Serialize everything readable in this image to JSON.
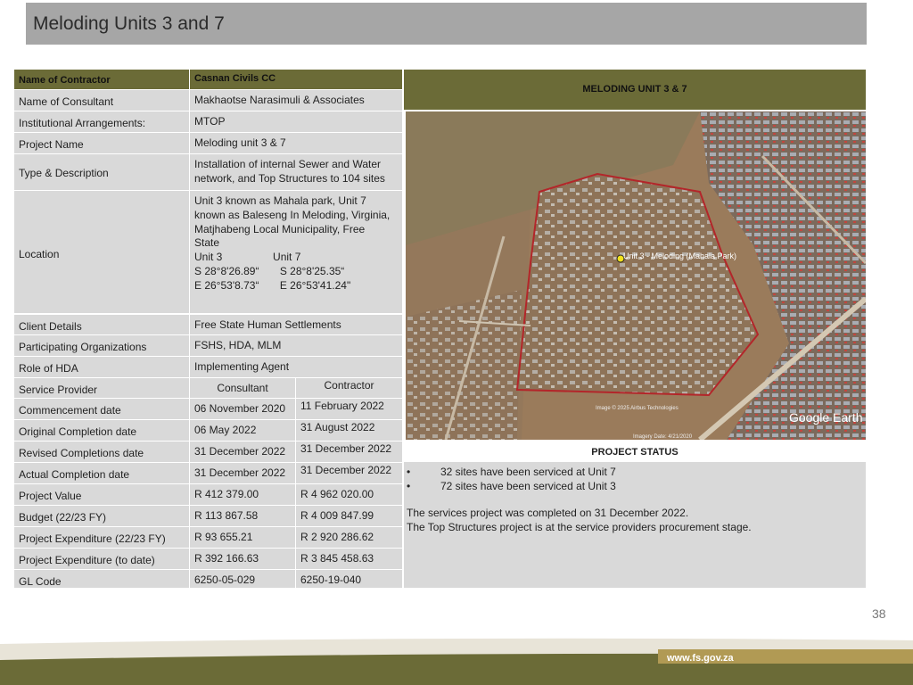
{
  "title": "Meloding Units 3 and 7",
  "header_label": "Name of Contractor",
  "header_value": "Casnan Civils CC",
  "rows": [
    {
      "label": "Name of Consultant",
      "value": "Makhaotse Narasimuli & Associates"
    },
    {
      "label": "Institutional Arrangements:",
      "value": "MTOP"
    },
    {
      "label": "Project Name",
      "value": "Meloding unit 3 & 7"
    },
    {
      "label": "Type & Description",
      "value_lines": [
        "Installation of internal Sewer and Water",
        "network, and Top Structures  to 104 sites"
      ]
    },
    {
      "label": "Location",
      "value_lines": [
        "Unit 3 known as Mahala park, Unit 7",
        "known as Baleseng In Meloding, Virginia,",
        "Matjhabeng Local Municipality, Free",
        "State",
        "Unit 3                 Unit 7",
        "S 28°8'26.89“       S 28°8'25.35“",
        "E 26°53'8.73“       E 26°53'41.24\""
      ]
    },
    {
      "label": "Client Details",
      "value": "Free State Human Settlements"
    },
    {
      "label": "Participating Organizations",
      "value": "FSHS, HDA, MLM"
    },
    {
      "label": "Role of HDA",
      "value": "Implementing Agent"
    }
  ],
  "split_rows": [
    {
      "label": "Service Provider",
      "v1": "Consultant",
      "v2": "Contractor"
    },
    {
      "label": "Commencement date",
      "v1": "06 November 2020",
      "v2": "11 February 2022"
    },
    {
      "label": "Original Completion date",
      "v1": "06 May 2022",
      "v2": "31 August 2022"
    },
    {
      "label": "Revised Completions date",
      "v1": "31 December 2022",
      "v2": "31 December 2022"
    },
    {
      "label": "Actual Completion date",
      "v1": "31 December 2022",
      "v2": "31 December 2022"
    },
    {
      "label": "Project Value",
      "v1": "R 412 379.00",
      "v2": "R 4 962 020.00"
    },
    {
      "label": "Budget (22/23 FY)",
      "v1": "R 113 867.58",
      "v2": "R 4 009 847.99"
    },
    {
      "label": "Project Expenditure (22/23 FY)",
      "v1": "R 93 655.21",
      "v2": "R 2 920 286.62"
    },
    {
      "label": "Project Expenditure (to date)",
      "v1": "R 392 166.63",
      "v2": "R 3 845 458.63"
    },
    {
      "label": "GL Code",
      "v1": "6250-05-029",
      "v2": "6250-19-040"
    }
  ],
  "right_header": "MELODING UNIT 3 & 7",
  "map": {
    "marker_label": "Unit 3 - Meloding (Mahala Park)",
    "brand": "Google Earth",
    "imagery_credit": "Image © 2025 Airbus Technologies",
    "imagery_date": "Imagery Date: 4/21/2020"
  },
  "status_header": "PROJECT STATUS",
  "status_bullets": [
    "32 sites have been serviced at Unit 7",
    "72 sites have been serviced at Unit 3"
  ],
  "status_paragraphs": [
    "The services project was completed on 31 December 2022.",
    "The Top Structures project is at the service providers procurement stage."
  ],
  "bullet_glyph": "•",
  "page_number": "38",
  "footer_url": "www.fs.gov.za",
  "colors": {
    "header_olive": "#6b6b37",
    "cell_grey": "#d9d9d9",
    "title_grey": "#a6a6a6",
    "footer_olive": "#6b6b37",
    "footer_gold": "#b19a54"
  }
}
